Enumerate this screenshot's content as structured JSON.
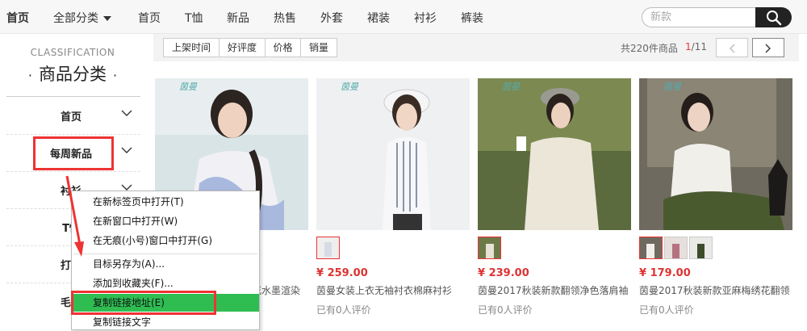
{
  "topnav": {
    "items": [
      "首页",
      "全部分类",
      "首页",
      "T恤",
      "新品",
      "热售",
      "外套",
      "裙装",
      "衬衫",
      "裤装"
    ],
    "search_placeholder": "新款"
  },
  "sidebar": {
    "eng": "CLASSIFICATION",
    "title": "商品分类",
    "title_dot": "·",
    "items": [
      {
        "label": "首页"
      },
      {
        "label": "每周新品"
      },
      {
        "label": "衬衫"
      },
      {
        "label": "T恤"
      },
      {
        "label": "打底"
      },
      {
        "label": "毛衣"
      }
    ]
  },
  "sortbar": {
    "buttons": [
      "上架时间",
      "好评度",
      "价格",
      "销量"
    ],
    "total": "共220件商品",
    "page_current": "1",
    "page_total": "/11"
  },
  "products": [
    {
      "brand": "茵曼",
      "price": "",
      "name": "花水墨渲染",
      "reviews": ""
    },
    {
      "brand": "茵曼",
      "price": "¥ 259.00",
      "name": "茵曼女装上衣无袖衬衣棉麻衬衫",
      "reviews": "已有0人评价"
    },
    {
      "brand": "茵曼",
      "price": "¥ 239.00",
      "name": "茵曼2017秋装新款翻领净色落肩袖",
      "reviews": "已有0人评价"
    },
    {
      "brand": "茵曼",
      "price": "¥ 179.00",
      "name": "茵曼2017秋装新款亚麻梅绣花翻领",
      "reviews": "已有0人评价"
    }
  ],
  "context_menu": {
    "items": [
      "在新标签页中打开(T)",
      "在新窗口中打开(W)",
      "在无痕(小号)窗口中打开(G)",
      "目标另存为(A)...",
      "添加到收藏夹(F)...",
      "复制链接地址(E)",
      "复制链接文字"
    ],
    "highlighted_index": 5
  },
  "colors": {
    "accent_red": "#e33333",
    "menu_highlight": "#2fbd52",
    "search_button": "#222222"
  }
}
